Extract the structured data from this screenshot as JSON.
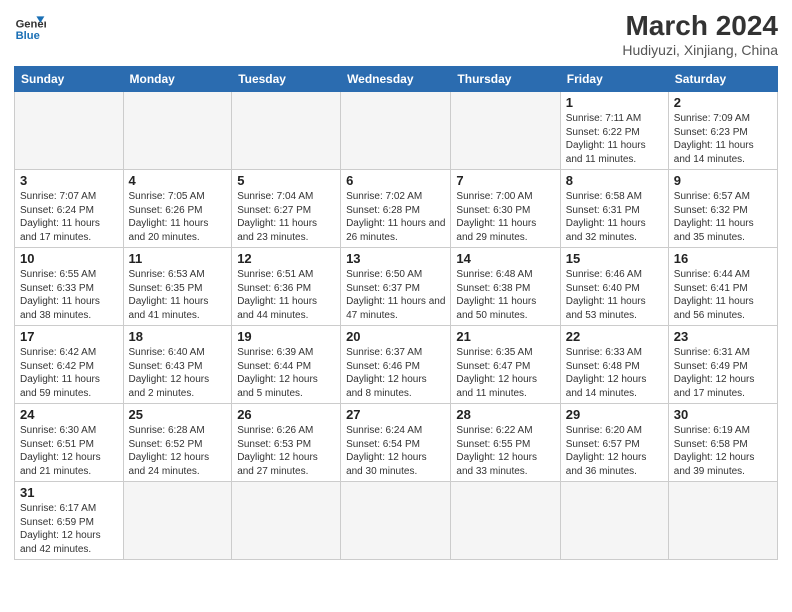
{
  "header": {
    "logo_general": "General",
    "logo_blue": "Blue",
    "month_year": "March 2024",
    "location": "Hudiyuzi, Xinjiang, China"
  },
  "days_of_week": [
    "Sunday",
    "Monday",
    "Tuesday",
    "Wednesday",
    "Thursday",
    "Friday",
    "Saturday"
  ],
  "weeks": [
    [
      {
        "day": "",
        "info": "",
        "empty": true
      },
      {
        "day": "",
        "info": "",
        "empty": true
      },
      {
        "day": "",
        "info": "",
        "empty": true
      },
      {
        "day": "",
        "info": "",
        "empty": true
      },
      {
        "day": "",
        "info": "",
        "empty": true
      },
      {
        "day": "1",
        "info": "Sunrise: 7:11 AM\nSunset: 6:22 PM\nDaylight: 11 hours and 11 minutes."
      },
      {
        "day": "2",
        "info": "Sunrise: 7:09 AM\nSunset: 6:23 PM\nDaylight: 11 hours and 14 minutes."
      }
    ],
    [
      {
        "day": "3",
        "info": "Sunrise: 7:07 AM\nSunset: 6:24 PM\nDaylight: 11 hours and 17 minutes."
      },
      {
        "day": "4",
        "info": "Sunrise: 7:05 AM\nSunset: 6:26 PM\nDaylight: 11 hours and 20 minutes."
      },
      {
        "day": "5",
        "info": "Sunrise: 7:04 AM\nSunset: 6:27 PM\nDaylight: 11 hours and 23 minutes."
      },
      {
        "day": "6",
        "info": "Sunrise: 7:02 AM\nSunset: 6:28 PM\nDaylight: 11 hours and 26 minutes."
      },
      {
        "day": "7",
        "info": "Sunrise: 7:00 AM\nSunset: 6:30 PM\nDaylight: 11 hours and 29 minutes."
      },
      {
        "day": "8",
        "info": "Sunrise: 6:58 AM\nSunset: 6:31 PM\nDaylight: 11 hours and 32 minutes."
      },
      {
        "day": "9",
        "info": "Sunrise: 6:57 AM\nSunset: 6:32 PM\nDaylight: 11 hours and 35 minutes."
      }
    ],
    [
      {
        "day": "10",
        "info": "Sunrise: 6:55 AM\nSunset: 6:33 PM\nDaylight: 11 hours and 38 minutes."
      },
      {
        "day": "11",
        "info": "Sunrise: 6:53 AM\nSunset: 6:35 PM\nDaylight: 11 hours and 41 minutes."
      },
      {
        "day": "12",
        "info": "Sunrise: 6:51 AM\nSunset: 6:36 PM\nDaylight: 11 hours and 44 minutes."
      },
      {
        "day": "13",
        "info": "Sunrise: 6:50 AM\nSunset: 6:37 PM\nDaylight: 11 hours and 47 minutes."
      },
      {
        "day": "14",
        "info": "Sunrise: 6:48 AM\nSunset: 6:38 PM\nDaylight: 11 hours and 50 minutes."
      },
      {
        "day": "15",
        "info": "Sunrise: 6:46 AM\nSunset: 6:40 PM\nDaylight: 11 hours and 53 minutes."
      },
      {
        "day": "16",
        "info": "Sunrise: 6:44 AM\nSunset: 6:41 PM\nDaylight: 11 hours and 56 minutes."
      }
    ],
    [
      {
        "day": "17",
        "info": "Sunrise: 6:42 AM\nSunset: 6:42 PM\nDaylight: 11 hours and 59 minutes."
      },
      {
        "day": "18",
        "info": "Sunrise: 6:40 AM\nSunset: 6:43 PM\nDaylight: 12 hours and 2 minutes."
      },
      {
        "day": "19",
        "info": "Sunrise: 6:39 AM\nSunset: 6:44 PM\nDaylight: 12 hours and 5 minutes."
      },
      {
        "day": "20",
        "info": "Sunrise: 6:37 AM\nSunset: 6:46 PM\nDaylight: 12 hours and 8 minutes."
      },
      {
        "day": "21",
        "info": "Sunrise: 6:35 AM\nSunset: 6:47 PM\nDaylight: 12 hours and 11 minutes."
      },
      {
        "day": "22",
        "info": "Sunrise: 6:33 AM\nSunset: 6:48 PM\nDaylight: 12 hours and 14 minutes."
      },
      {
        "day": "23",
        "info": "Sunrise: 6:31 AM\nSunset: 6:49 PM\nDaylight: 12 hours and 17 minutes."
      }
    ],
    [
      {
        "day": "24",
        "info": "Sunrise: 6:30 AM\nSunset: 6:51 PM\nDaylight: 12 hours and 21 minutes."
      },
      {
        "day": "25",
        "info": "Sunrise: 6:28 AM\nSunset: 6:52 PM\nDaylight: 12 hours and 24 minutes."
      },
      {
        "day": "26",
        "info": "Sunrise: 6:26 AM\nSunset: 6:53 PM\nDaylight: 12 hours and 27 minutes."
      },
      {
        "day": "27",
        "info": "Sunrise: 6:24 AM\nSunset: 6:54 PM\nDaylight: 12 hours and 30 minutes."
      },
      {
        "day": "28",
        "info": "Sunrise: 6:22 AM\nSunset: 6:55 PM\nDaylight: 12 hours and 33 minutes."
      },
      {
        "day": "29",
        "info": "Sunrise: 6:20 AM\nSunset: 6:57 PM\nDaylight: 12 hours and 36 minutes."
      },
      {
        "day": "30",
        "info": "Sunrise: 6:19 AM\nSunset: 6:58 PM\nDaylight: 12 hours and 39 minutes."
      }
    ],
    [
      {
        "day": "31",
        "info": "Sunrise: 6:17 AM\nSunset: 6:59 PM\nDaylight: 12 hours and 42 minutes."
      },
      {
        "day": "",
        "info": "",
        "empty": true
      },
      {
        "day": "",
        "info": "",
        "empty": true
      },
      {
        "day": "",
        "info": "",
        "empty": true
      },
      {
        "day": "",
        "info": "",
        "empty": true
      },
      {
        "day": "",
        "info": "",
        "empty": true
      },
      {
        "day": "",
        "info": "",
        "empty": true
      }
    ]
  ]
}
